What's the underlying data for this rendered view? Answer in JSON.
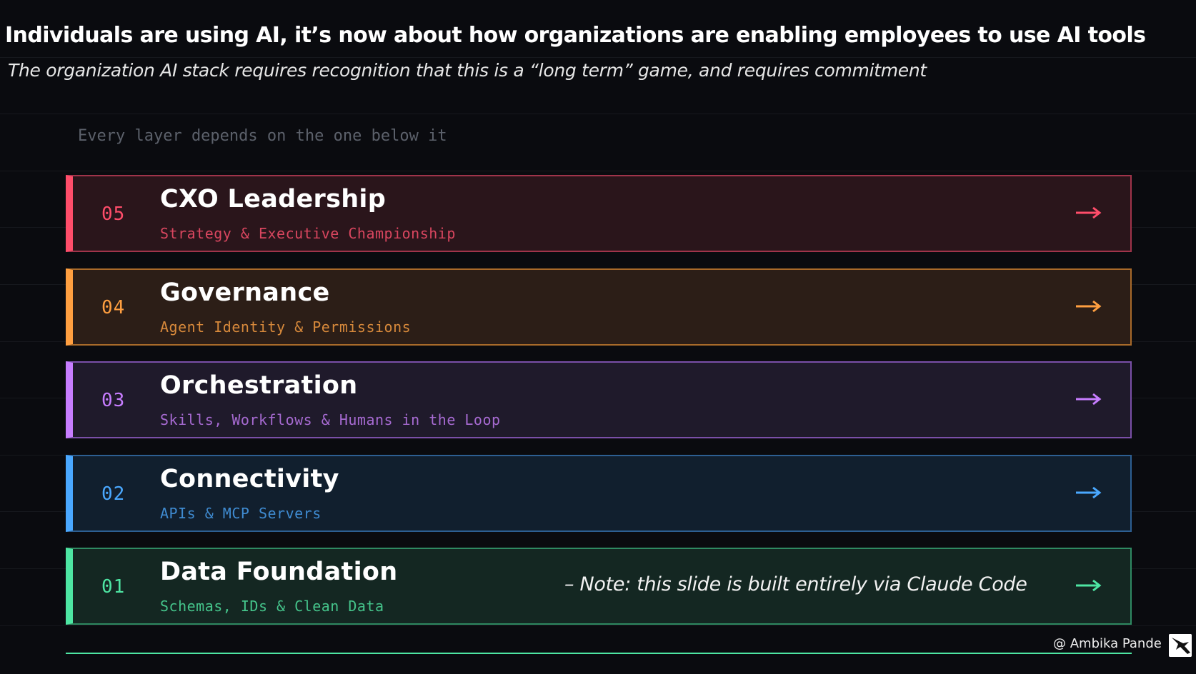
{
  "title": "Individuals are using AI, it’s now about how organizations are enabling employees to use AI tools",
  "subtitle": "The organization AI stack requires recognition that this is a “long term” game, and requires commitment",
  "caption": "Every layer depends on the one below it",
  "layers": [
    {
      "number": "05",
      "name": "CXO Leadership",
      "description": "Strategy & Executive Championship",
      "accent": "#ff4d6a",
      "accent_text": "#d9465f",
      "background": "#2a151b",
      "border": "#a0344a",
      "arrow_icon": "arrow-right-icon"
    },
    {
      "number": "04",
      "name": "Governance",
      "description": "Agent Identity & Permissions",
      "accent": "#ff9f40",
      "accent_text": "#d7893b",
      "background": "#2c1e17",
      "border": "#a86a2a",
      "arrow_icon": "arrow-right-icon"
    },
    {
      "number": "03",
      "name": "Orchestration",
      "description": "Skills, Workflows & Humans in the Loop",
      "accent": "#c77dff",
      "accent_text": "#a66ad1",
      "background": "#1f1a2b",
      "border": "#7a4fa8",
      "arrow_icon": "arrow-right-icon"
    },
    {
      "number": "02",
      "name": "Connectivity",
      "description": "APIs & MCP Servers",
      "accent": "#4aa8ff",
      "accent_text": "#3f8bd1",
      "background": "#111f2e",
      "border": "#2d5f92",
      "arrow_icon": "arrow-right-icon"
    },
    {
      "number": "01",
      "name": "Data Foundation",
      "description": "Schemas, IDs & Clean Data",
      "accent": "#4ee6a3",
      "accent_text": "#45c48b",
      "background": "#142722",
      "border": "#2f8a62",
      "arrow_icon": "arrow-right-icon"
    }
  ],
  "note": "– Note: this slide is built entirely via Claude Code",
  "credit": "@ Ambika Pande",
  "logo_icon": "bird-logo-icon"
}
